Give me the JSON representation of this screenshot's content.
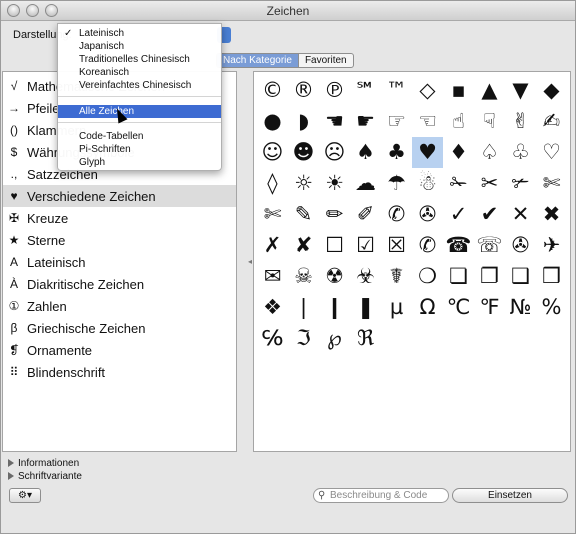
{
  "window": {
    "title": "Zeichen"
  },
  "toolbar": {
    "view_label": "Darstellung:",
    "tabs": [
      {
        "label": "Nach Kategorie",
        "selected": true
      },
      {
        "label": "Favoriten",
        "selected": false
      }
    ]
  },
  "view_menu": {
    "items": [
      {
        "label": "Lateinisch",
        "checked": true,
        "highlighted": false
      },
      {
        "label": "Japanisch",
        "checked": false,
        "highlighted": false
      },
      {
        "label": "Traditionelles Chinesisch",
        "checked": false,
        "highlighted": false
      },
      {
        "label": "Koreanisch",
        "checked": false,
        "highlighted": false
      },
      {
        "label": "Vereinfachtes Chinesisch",
        "checked": false,
        "highlighted": false
      },
      {
        "label": "Alle Zeichen",
        "checked": false,
        "highlighted": true
      },
      {
        "label": "Code-Tabellen",
        "checked": false,
        "highlighted": false
      },
      {
        "label": "Pi-Schriften",
        "checked": false,
        "highlighted": false
      },
      {
        "label": "Glyph",
        "checked": false,
        "highlighted": false
      }
    ],
    "check_glyph": "✓"
  },
  "categories": [
    {
      "icon": "√",
      "label": "Mathematische Zeichen"
    },
    {
      "icon": "→",
      "label": "Pfeile"
    },
    {
      "icon": "()",
      "label": "Klammern"
    },
    {
      "icon": "$",
      "label": "Währungssymbole"
    },
    {
      "icon": ".,",
      "label": "Satzzeichen"
    },
    {
      "icon": "♥",
      "label": "Verschiedene Zeichen",
      "selected": true
    },
    {
      "icon": "✠",
      "label": "Kreuze"
    },
    {
      "icon": "★",
      "label": "Sterne"
    },
    {
      "icon": "A",
      "label": "Lateinisch"
    },
    {
      "icon": "À",
      "label": "Diakritische Zeichen"
    },
    {
      "icon": "①",
      "label": "Zahlen"
    },
    {
      "icon": "β",
      "label": "Griechische Zeichen"
    },
    {
      "icon": "❡",
      "label": "Ornamente"
    },
    {
      "icon": "⠿",
      "label": "Blindenschrift"
    }
  ],
  "glyph_rows": [
    [
      "©",
      "®",
      "℗",
      "℠",
      "™",
      "◇",
      "▪",
      "▲",
      "▼",
      "◆"
    ],
    [
      "●",
      "◗",
      "☚",
      "☛",
      "☞",
      "☜",
      "☝",
      "☟",
      "✌",
      "✍"
    ],
    [
      "☺",
      "☻",
      "☹",
      "♠",
      "♣",
      "♥",
      "♦",
      "♤",
      "♧",
      "♡"
    ],
    [
      "◊",
      "☼",
      "☀",
      "☁",
      "☂",
      "☃",
      "✁",
      "✂",
      "✃",
      "✄"
    ],
    [
      "✄",
      "✎",
      "✏",
      "✐",
      "✆",
      "✇",
      "✓",
      "✔",
      "✕",
      "✖"
    ],
    [
      "✗",
      "✘",
      "☐",
      "☑",
      "☒",
      "✆",
      "☎",
      "☏",
      "✇",
      "✈"
    ],
    [
      "✉",
      "☠",
      "☢",
      "☣",
      "☤",
      "❍",
      "❏",
      "❐",
      "❑",
      "❒"
    ],
    [
      "❖",
      "❘",
      "❙",
      "❚",
      "µ",
      "Ω",
      "℃",
      "℉",
      "№",
      "%"
    ],
    [
      "℅",
      "ℑ",
      "℘",
      "ℜ"
    ]
  ],
  "selected_glyph": "♥",
  "info": {
    "informationen": "Informationen",
    "schriftvariante": "Schriftvariante"
  },
  "bottom": {
    "gear": "⚙▾",
    "search_placeholder": "Beschreibung & Code",
    "insert_button": "Einsetzen"
  }
}
